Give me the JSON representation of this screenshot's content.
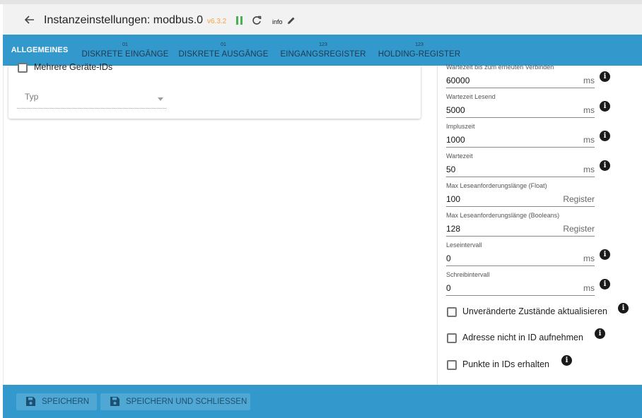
{
  "header": {
    "title": "Instanzeinstellungen: modbus.0",
    "version": "v6.3.2",
    "info_link": "info"
  },
  "tabs": [
    {
      "label": "ALLGEMEINES",
      "sup": ""
    },
    {
      "label": "DISKRETE EINGÄNGE",
      "sup": "01"
    },
    {
      "label": "DISKRETE AUSGÄNGE",
      "sup": "01"
    },
    {
      "label": "EINGANGSREGISTER",
      "sup": "123"
    },
    {
      "label": "HOLDING-REGISTER",
      "sup": "123"
    }
  ],
  "left": {
    "multi_ids_label": "Mehrere Geräte-IDs",
    "typ_placeholder": "Typ"
  },
  "fields": [
    {
      "label": "Wartezeit bis zum erneuten Verbinden",
      "value": "60000",
      "unit": "ms"
    },
    {
      "label": "Wartezeit Lesend",
      "value": "5000",
      "unit": "ms"
    },
    {
      "label": "Impluszeit",
      "value": "1000",
      "unit": "ms"
    },
    {
      "label": "Wartezeit",
      "value": "50",
      "unit": "ms"
    },
    {
      "label": "Max Leseanforderungslänge (Float)",
      "value": "100",
      "unit": "Register"
    },
    {
      "label": "Max Leseanforderungslänge (Booleans)",
      "value": "128",
      "unit": "Register"
    },
    {
      "label": "Leseintervall",
      "value": "0",
      "unit": "ms"
    },
    {
      "label": "Schreibintervall",
      "value": "0",
      "unit": "ms"
    }
  ],
  "checkboxes": [
    {
      "label": "Unveränderte Zustände aktualisieren"
    },
    {
      "label": "Adresse nicht in ID aufnehmen"
    },
    {
      "label": "Punkte in IDs erhalten"
    }
  ],
  "footer": {
    "save_label": "SPEICHERN",
    "save_close_label": "SPEICHERN UND SCHLIESSEN"
  },
  "icons": {
    "back": "arrow-left-icon",
    "pause": "pause-icon",
    "reload": "reload-icon",
    "edit": "pencil-icon",
    "info": "info-icon",
    "save": "floppy-disk-icon"
  },
  "colors": {
    "accent": "#3399cc",
    "version": "#f4a43a",
    "pause": "#4caf50"
  }
}
